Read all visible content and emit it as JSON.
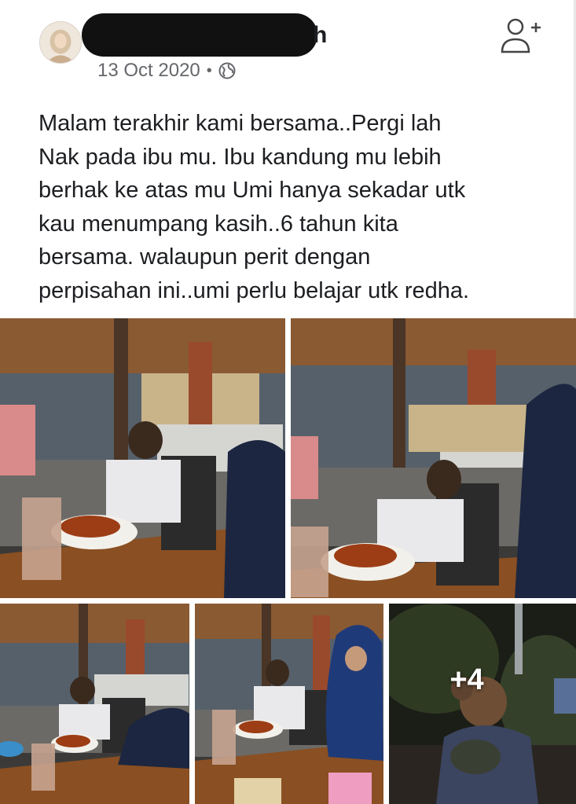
{
  "post": {
    "author_name_visible_tail": "h",
    "date": "13 Oct 2020",
    "separator": "•",
    "privacy_icon": "globe-icon",
    "follow_icon": "add-friend-icon",
    "text_lines": [
      "Malam terakhir kami bersama..Pergi lah",
      "Nak pada ibu mu. Ibu kandung mu lebih",
      "berhak ke atas mu Umi hanya sekadar utk",
      "kau menumpang kasih..6 tahun kita",
      "bersama. walaupun perit dengan",
      "perpisahan ini..umi perlu belajar utk redha."
    ]
  },
  "photos": {
    "more_count": "+4"
  },
  "colors": {
    "text": "#1c1e21",
    "meta": "#65676b",
    "redaction": "#111111"
  }
}
